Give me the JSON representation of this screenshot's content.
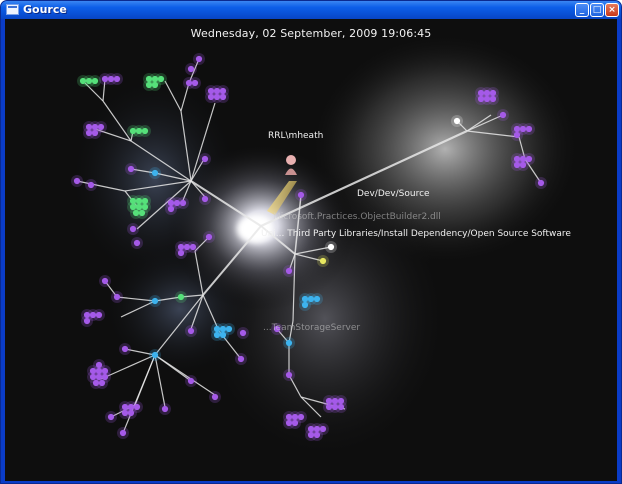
{
  "window": {
    "title": "Gource",
    "minimize_symbol": "_",
    "maximize_symbol": "□",
    "close_symbol": "×"
  },
  "overlay": {
    "datetime": "Wednesday, 02 September, 2009 19:06:45"
  },
  "labels": {
    "user": "RRL\\mheath",
    "dir_source": "Dev/Dev/Source",
    "dir_third_party": "Uni... Third Party Libraries/Install Dependency/Open Source Software",
    "file_faint_1": "Microsoft.Practices.ObjectBuilder2.dll",
    "file_faint_2": "...TeamStorageServer"
  },
  "colors": {
    "background": "#0e0e0e",
    "branch": "#e8e8e8",
    "file_purple": "#a55ae8",
    "file_green": "#56e07a",
    "file_cyan": "#3db3ee",
    "file_white": "#ffffff",
    "file_yellow": "#e8e860",
    "user_beam": "#f2d25a",
    "user_avatar": "#e8b0b0"
  }
}
